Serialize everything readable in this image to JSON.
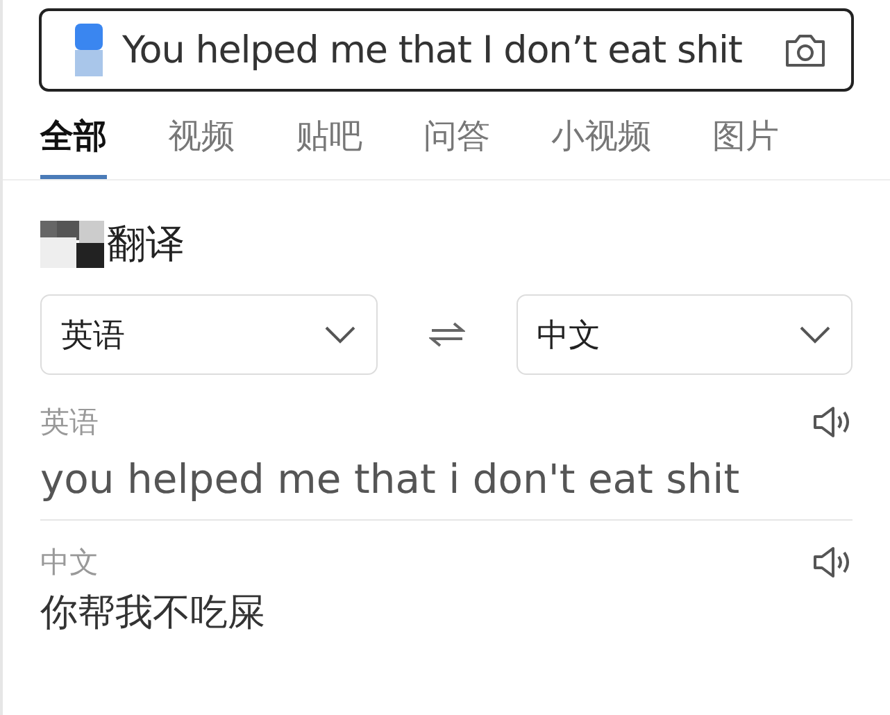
{
  "search": {
    "value": "You helped me that I don’t eat shit"
  },
  "tabs": [
    {
      "label": "全部",
      "selected": true
    },
    {
      "label": "视频",
      "selected": false
    },
    {
      "label": "贴吧",
      "selected": false
    },
    {
      "label": "问答",
      "selected": false
    },
    {
      "label": "小视频",
      "selected": false
    },
    {
      "label": "图片",
      "selected": false
    }
  ],
  "translator": {
    "title": "翻译",
    "source_language": "英语",
    "target_language": "中文",
    "source": {
      "language": "英语",
      "text": "you helped me that i don't eat shit"
    },
    "result": {
      "language": "中文",
      "text": "你帮我不吃屎"
    }
  }
}
